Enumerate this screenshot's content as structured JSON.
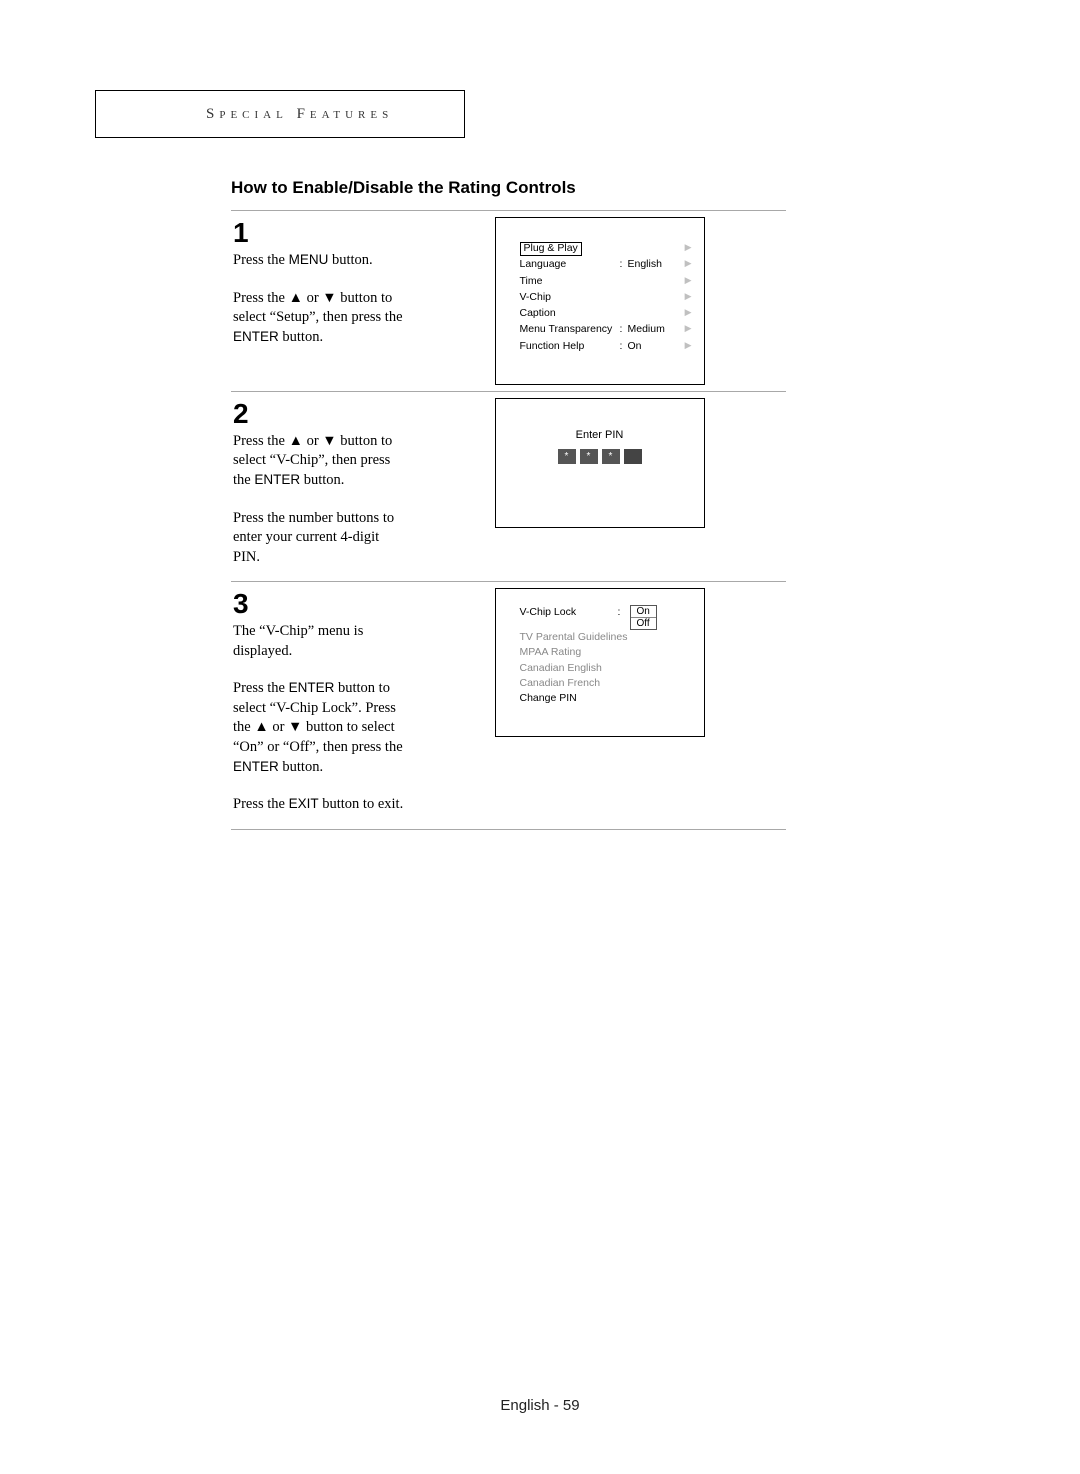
{
  "section_header": "Special Features",
  "page_title": "How to Enable/Disable the Rating Controls",
  "steps": {
    "s1": {
      "num": "1",
      "p1_a": "Press the ",
      "p1_btn": "MENU",
      "p1_b": " button.",
      "p2_a": "Press the ",
      "p2_glyph1": "▲",
      "p2_mid": " or ",
      "p2_glyph2": "▼",
      "p2_b": " button to select “Setup”, then press the ",
      "p2_btn": "ENTER",
      "p2_c": " button."
    },
    "s2": {
      "num": "2",
      "p1_a": "Press the ",
      "p1_glyph1": "▲",
      "p1_mid": " or ",
      "p1_glyph2": "▼",
      "p1_b": " button to select “V-Chip”, then press the ",
      "p1_btn": "ENTER",
      "p1_c": " button.",
      "p2": "Press the number buttons to enter your current 4-digit PIN."
    },
    "s3": {
      "num": "3",
      "p1": "The “V-Chip” menu is displayed.",
      "p2_a": "Press the ",
      "p2_btn1": "ENTER",
      "p2_b": " button to select “V-Chip Lock”. Press the ",
      "p2_glyph1": "▲",
      "p2_mid": " or ",
      "p2_glyph2": "▼",
      "p2_c": " button to select “On” or “Off”, then press the ",
      "p2_btn2": "ENTER",
      "p2_d": " button.",
      "p3_a": "Press the ",
      "p3_btn": "EXIT",
      "p3_b": " button to exit."
    }
  },
  "osd1": {
    "items": [
      {
        "label": "Plug & Play",
        "sep": "",
        "val": "",
        "hl": true
      },
      {
        "label": "Language",
        "sep": ":",
        "val": "English",
        "hl": false
      },
      {
        "label": "Time",
        "sep": "",
        "val": "",
        "hl": false
      },
      {
        "label": "V-Chip",
        "sep": "",
        "val": "",
        "hl": false
      },
      {
        "label": "Caption",
        "sep": "",
        "val": "",
        "hl": false
      },
      {
        "label": "Menu Transparency",
        "sep": ":",
        "val": "Medium",
        "hl": false
      },
      {
        "label": "Function Help",
        "sep": ":",
        "val": "On",
        "hl": false
      }
    ],
    "arrow": "▶"
  },
  "osd2": {
    "title": "Enter PIN",
    "star": "*"
  },
  "osd3": {
    "row1_label": "V-Chip Lock",
    "row1_sep": ":",
    "dd_on": "On",
    "dd_off": "Off",
    "items_dim": [
      "TV Parental Guidelines",
      "MPAA Rating",
      "Canadian English",
      "Canadian French"
    ],
    "change_pin": "Change PIN"
  },
  "footer": "English - 59"
}
